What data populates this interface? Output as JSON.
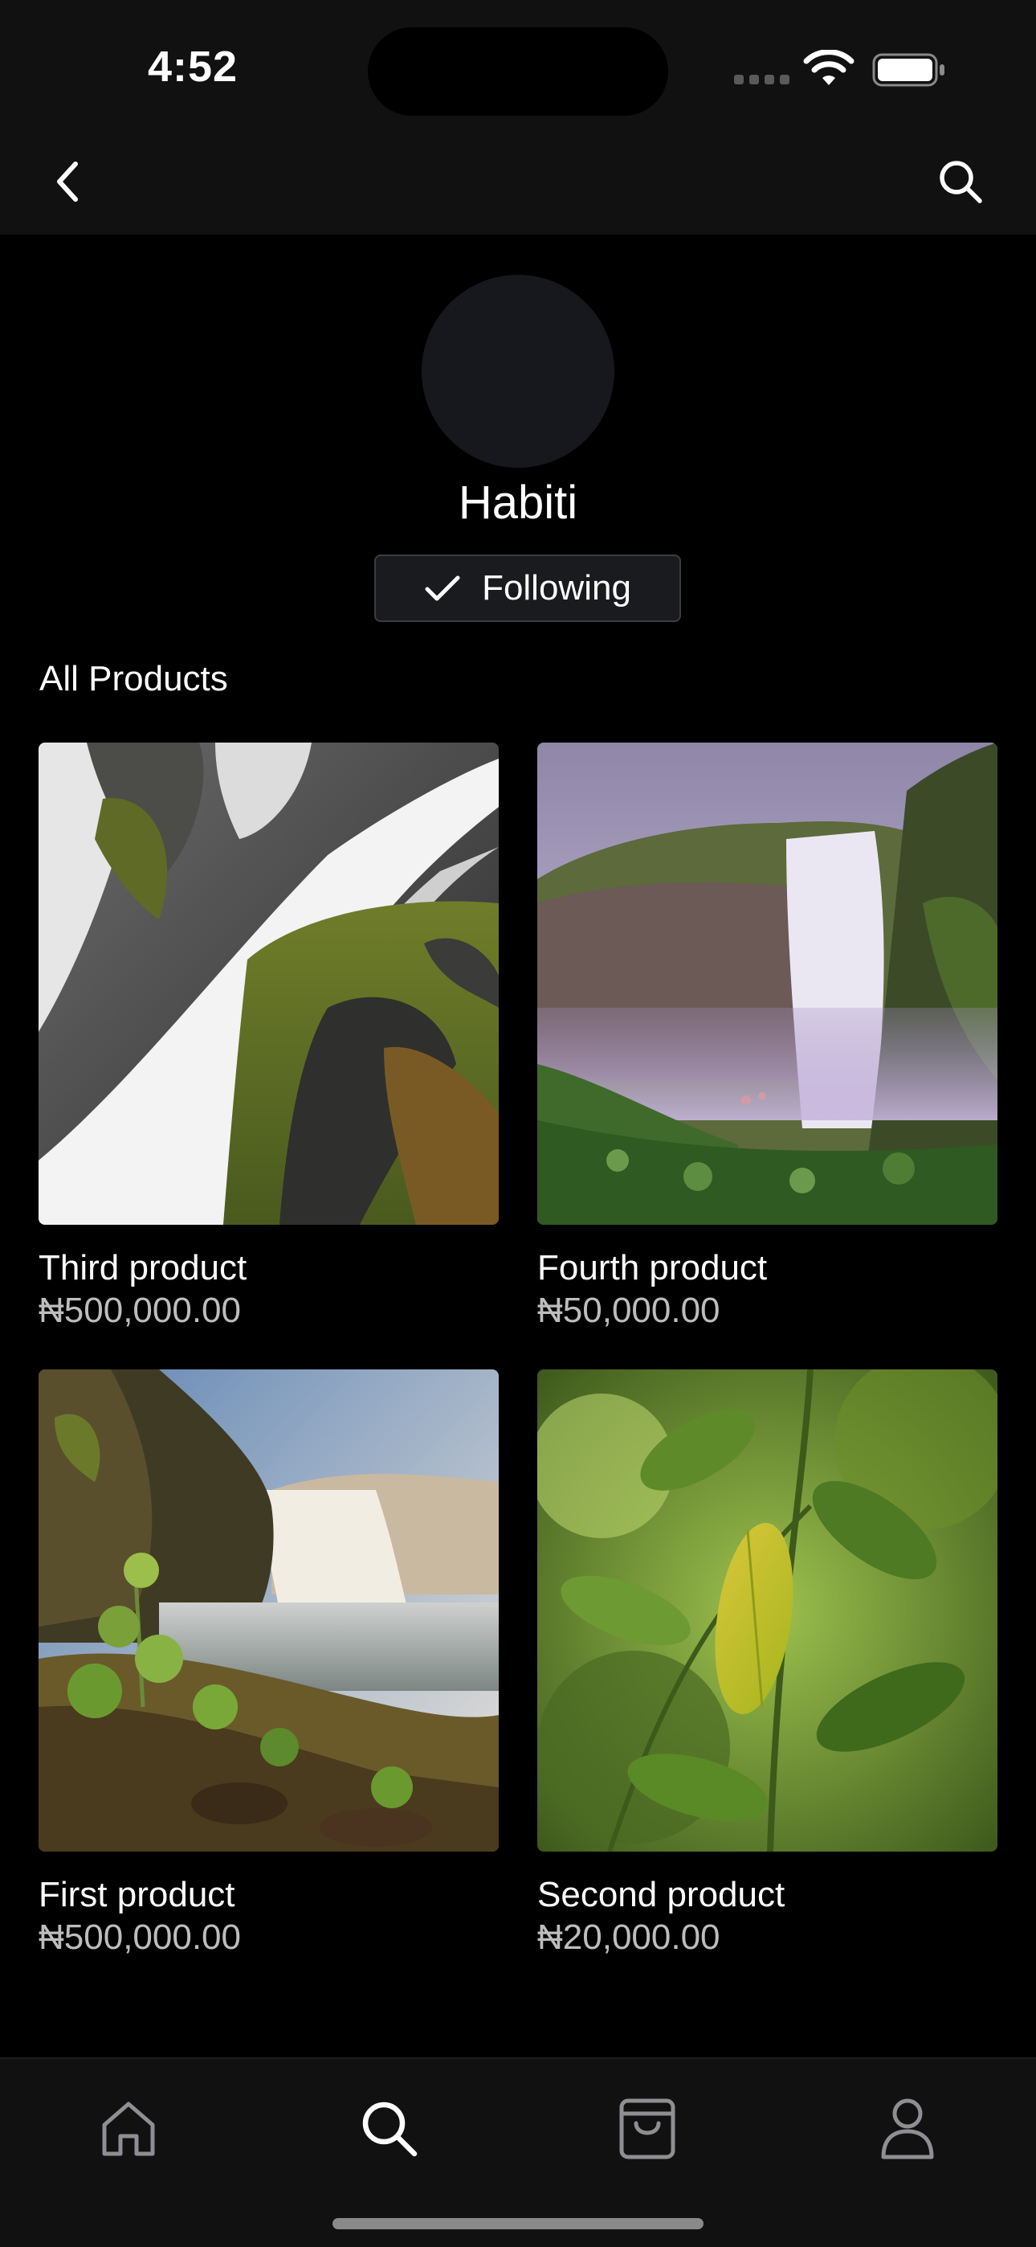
{
  "status_bar": {
    "time": "4:52"
  },
  "nav": {
    "back_icon": "chevron-left-icon",
    "search_icon": "search-icon"
  },
  "profile": {
    "name": "Habiti",
    "follow_label": "Following",
    "follow_icon": "checkmark-icon"
  },
  "section": {
    "title": "All Products"
  },
  "products": [
    {
      "name": "Third product",
      "price": "₦500,000.00"
    },
    {
      "name": "Fourth product",
      "price": "₦50,000.00"
    },
    {
      "name": "First product",
      "price": "₦500,000.00"
    },
    {
      "name": "Second product",
      "price": "₦20,000.00"
    }
  ],
  "tabs": [
    {
      "id": "home",
      "icon": "home-icon",
      "active": false
    },
    {
      "id": "explore",
      "icon": "search-icon",
      "active": true
    },
    {
      "id": "cart",
      "icon": "shopping-bag-icon",
      "active": false
    },
    {
      "id": "profile",
      "icon": "person-icon",
      "active": false
    }
  ],
  "colors": {
    "background": "#000000",
    "bar_background": "#111111",
    "price_text": "#bdbdbd",
    "inactive_tab": "#8e8e93",
    "active_tab": "#ffffff"
  }
}
